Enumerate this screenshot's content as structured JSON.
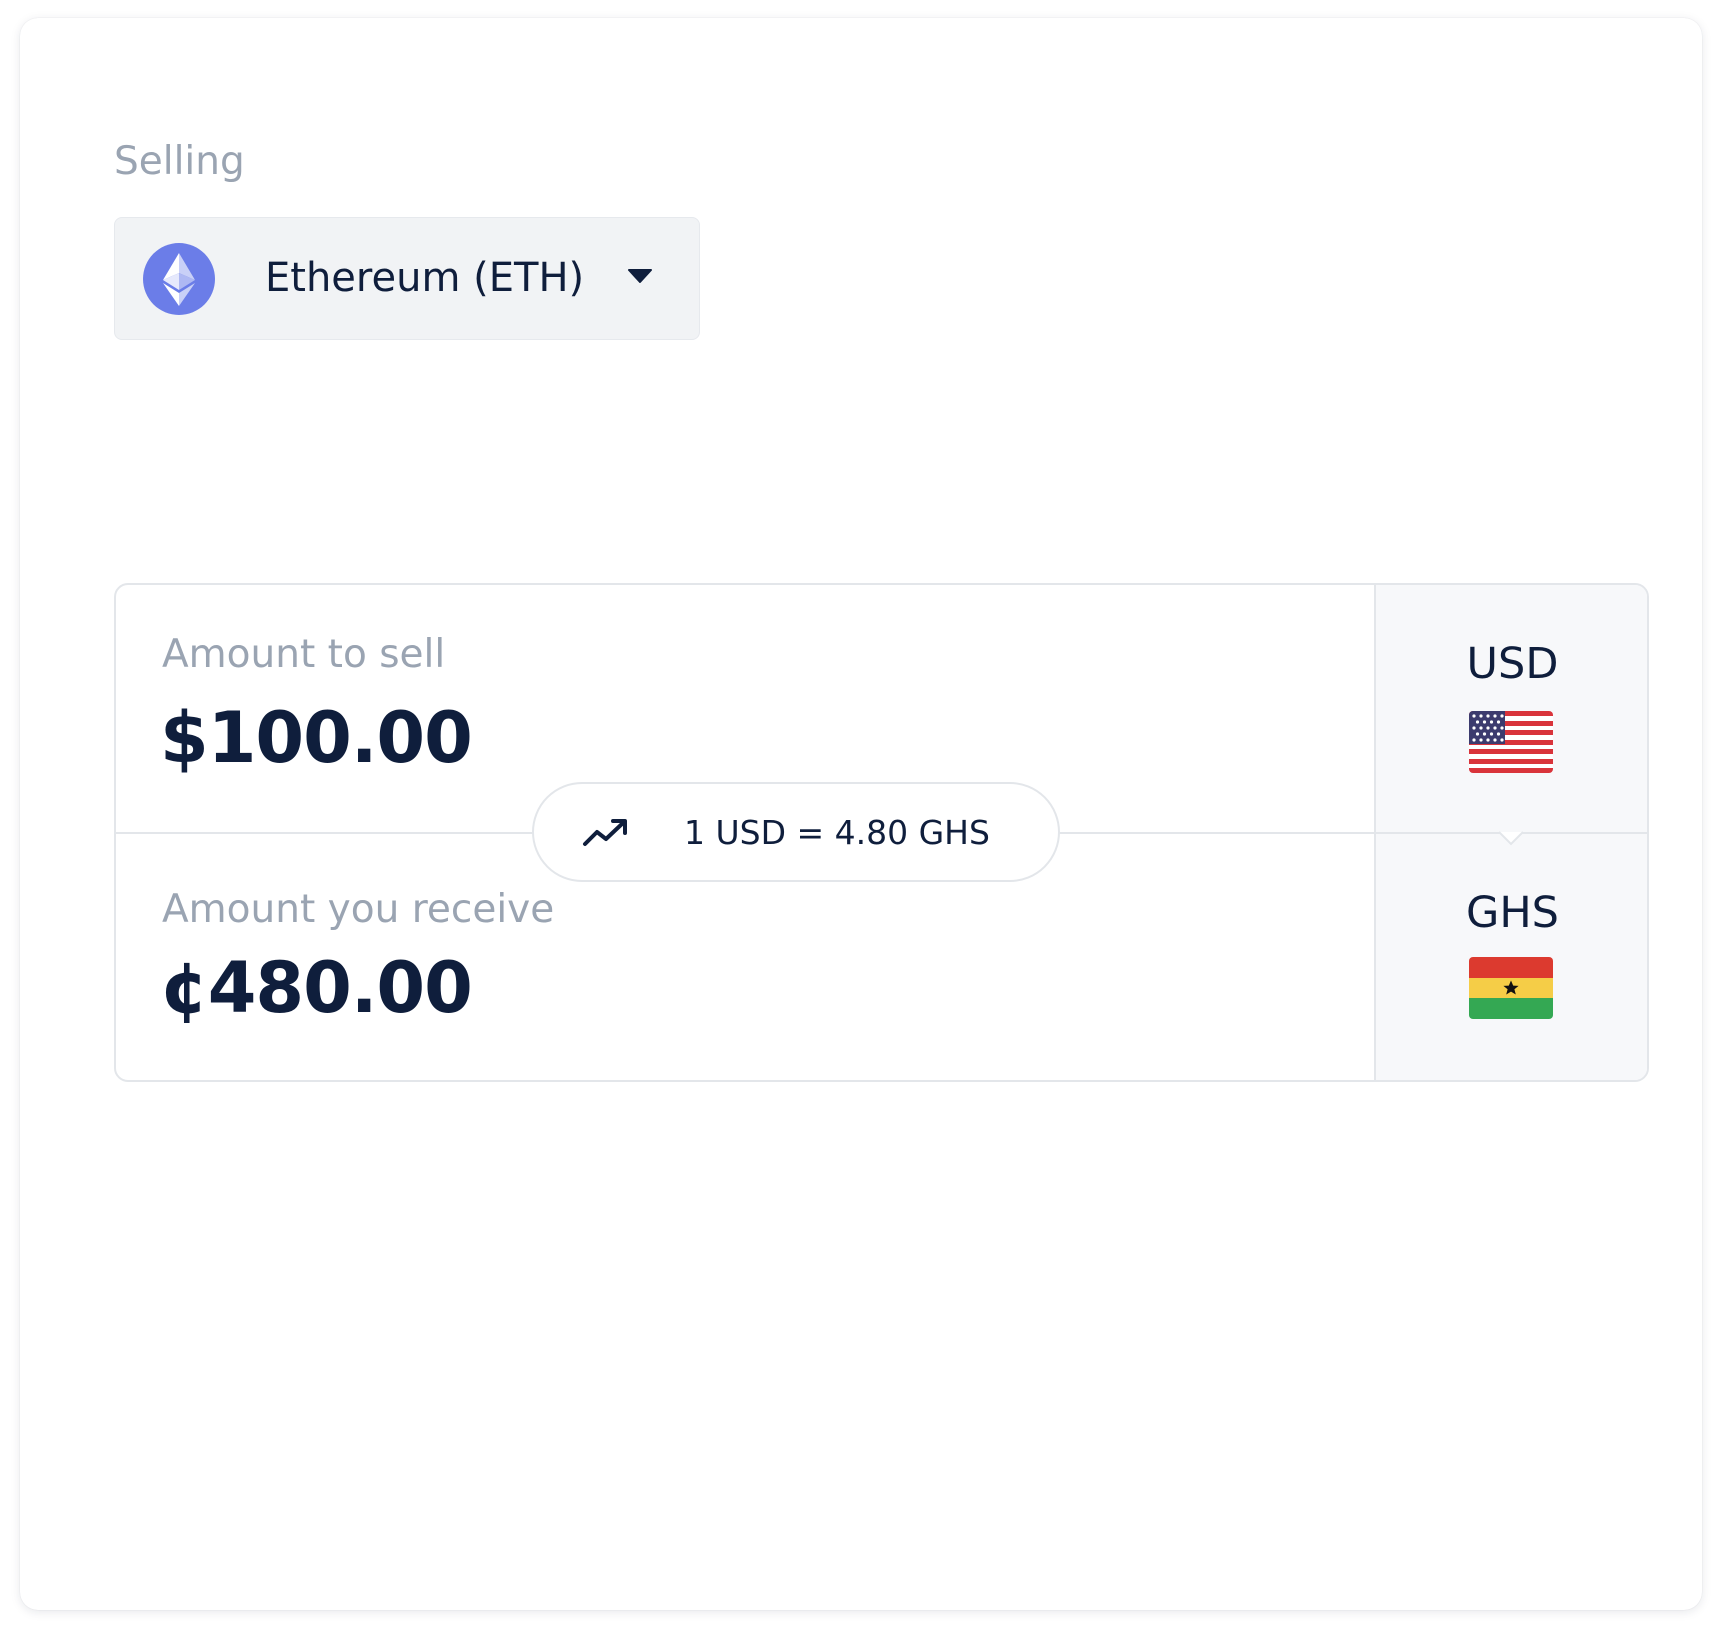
{
  "selling": {
    "label": "Selling",
    "asset_name": "Ethereum (ETH)",
    "asset_icon": "ethereum-icon",
    "dropdown_icon": "caret-down-icon"
  },
  "converter": {
    "sell": {
      "label": "Amount to sell",
      "value": "$100.00",
      "currency_code": "USD",
      "flag_icon": "us-flag-icon"
    },
    "receive": {
      "label": "Amount you receive",
      "value": "¢480.00",
      "currency_code": "GHS",
      "flag_icon": "ghana-flag-icon"
    },
    "rate": {
      "icon": "trending-up-icon",
      "text": "1 USD = 4.80 GHS"
    }
  },
  "colors": {
    "text_primary": "#0f1e3c",
    "text_muted": "#9aa4b2",
    "ethereum": "#6b7de8",
    "border": "#e3e6ea",
    "select_background": "#f1f3f5"
  }
}
